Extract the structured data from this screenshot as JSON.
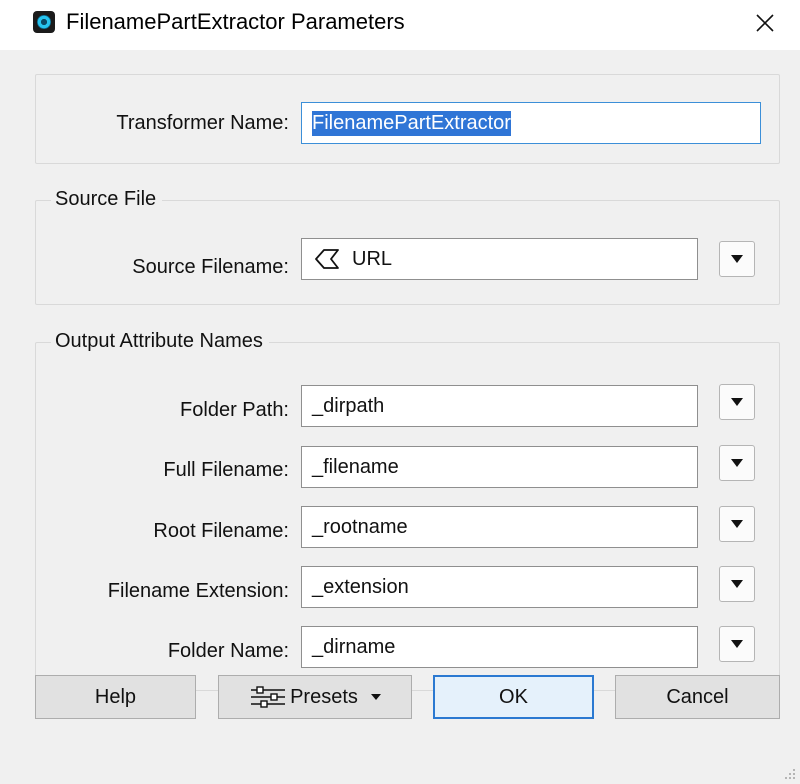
{
  "window": {
    "title": "FilenamePartExtractor Parameters",
    "close_icon": "close-icon",
    "app_icon": "fme-app-icon"
  },
  "transformer": {
    "label": "Transformer Name:",
    "value": "FilenamePartExtractor"
  },
  "source_file": {
    "group_title": "Source File",
    "label": "Source Filename:",
    "value": "URL",
    "value_icon": "attribute-value-icon"
  },
  "output": {
    "group_title": "Output Attribute Names",
    "fields": [
      {
        "label": "Folder Path:",
        "value": "_dirpath"
      },
      {
        "label": "Full Filename:",
        "value": "_filename"
      },
      {
        "label": "Root Filename:",
        "value": "_rootname"
      },
      {
        "label": "Filename Extension:",
        "value": "_extension"
      },
      {
        "label": "Folder Name:",
        "value": "_dirname"
      }
    ]
  },
  "buttons": {
    "help": "Help",
    "presets": "Presets",
    "ok": "OK",
    "cancel": "Cancel"
  },
  "colors": {
    "selection": "#2f75d6",
    "focus_border": "#3c8fd8",
    "default_button_border": "#2b79d1"
  }
}
